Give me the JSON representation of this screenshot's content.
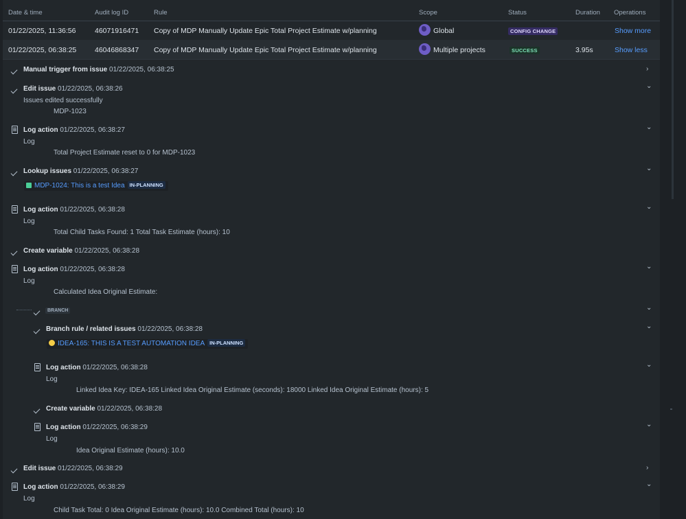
{
  "table": {
    "headers": [
      "Date & time",
      "Audit log ID",
      "Rule",
      "Scope",
      "Status",
      "Duration",
      "Operations"
    ],
    "rows": [
      {
        "datetime": "01/22/2025, 11:36:56",
        "id": "46071916471",
        "rule": "Copy of MDP Manually Update Epic Total Project Estimate w/planning",
        "scope": "Global",
        "status": "CONFIG CHANGE",
        "duration": "",
        "op": "Show more"
      },
      {
        "datetime": "01/22/2025, 06:38:25",
        "id": "46046868347",
        "rule": "Copy of MDP Manually Update Epic Total Project Estimate w/planning",
        "scope": "Multiple projects",
        "status": "SUCCESS",
        "duration": "3.95s",
        "op": "Show less"
      }
    ]
  },
  "details": [
    {
      "icon": "check",
      "title": "Manual trigger from issue",
      "time": "01/22/2025, 06:38:25",
      "chevron": "›"
    },
    {
      "icon": "check",
      "title": "Edit issue",
      "time": "01/22/2025, 06:38:26",
      "chevron": "⌄",
      "sub": "Issues edited successfully",
      "value": "MDP-1023"
    },
    {
      "icon": "doc",
      "title": "Log action",
      "time": "01/22/2025, 06:38:27",
      "chevron": "⌄",
      "sub": "Log",
      "value": "Total Project Estimate reset to 0 for MDP-1023"
    },
    {
      "icon": "check",
      "title": "Lookup issues",
      "time": "01/22/2025, 06:38:27",
      "chevron": "⌄",
      "issue": "MDP-1024: This is a test Idea",
      "issue_status": "IN-PLANNING"
    },
    {
      "icon": "doc",
      "title": "Log action",
      "time": "01/22/2025, 06:38:28",
      "chevron": "⌄",
      "sub": "Log",
      "value": "Total Child Tasks Found: 1 Total Task Estimate (hours): 10"
    },
    {
      "icon": "check",
      "title": "Create variable",
      "time": "01/22/2025, 06:38:28"
    },
    {
      "icon": "doc",
      "title": "Log action",
      "time": "01/22/2025, 06:38:28",
      "chevron": "⌄",
      "sub": "Log",
      "value": "Calculated Idea Original Estimate:"
    },
    {
      "branch_tag": "BRANCH",
      "chevron": "⌄"
    },
    {
      "icon": "check",
      "title": "Branch rule / related issues",
      "time": "01/22/2025, 06:38:28",
      "chevron": "⌄",
      "issue": "IDEA-165: THIS IS A TEST AUTOMATION IDEA",
      "issue_status": "IN-PLANNING"
    },
    {
      "icon": "doc",
      "title": "Log action",
      "time": "01/22/2025, 06:38:28",
      "chevron": "⌄",
      "sub": "Log",
      "value": "Linked Idea Key: IDEA-165 Linked Idea Original Estimate (seconds): 18000 Linked Idea Original Estimate (hours): 5"
    },
    {
      "icon": "check",
      "title": "Create variable",
      "time": "01/22/2025, 06:38:28"
    },
    {
      "icon": "doc",
      "title": "Log action",
      "time": "01/22/2025, 06:38:29",
      "chevron": "⌄",
      "sub": "Log",
      "value": "Idea Original Estimate (hours): 10.0"
    },
    {
      "icon": "check",
      "title": "Edit issue",
      "time": "01/22/2025, 06:38:29",
      "chevron": "›"
    },
    {
      "icon": "doc",
      "title": "Log action",
      "time": "01/22/2025, 06:38:29",
      "chevron": "⌄",
      "sub": "Log",
      "value": "Child Task Total: 0 Idea Original Estimate (hours): 10.0 Combined Total (hours): 10"
    }
  ]
}
